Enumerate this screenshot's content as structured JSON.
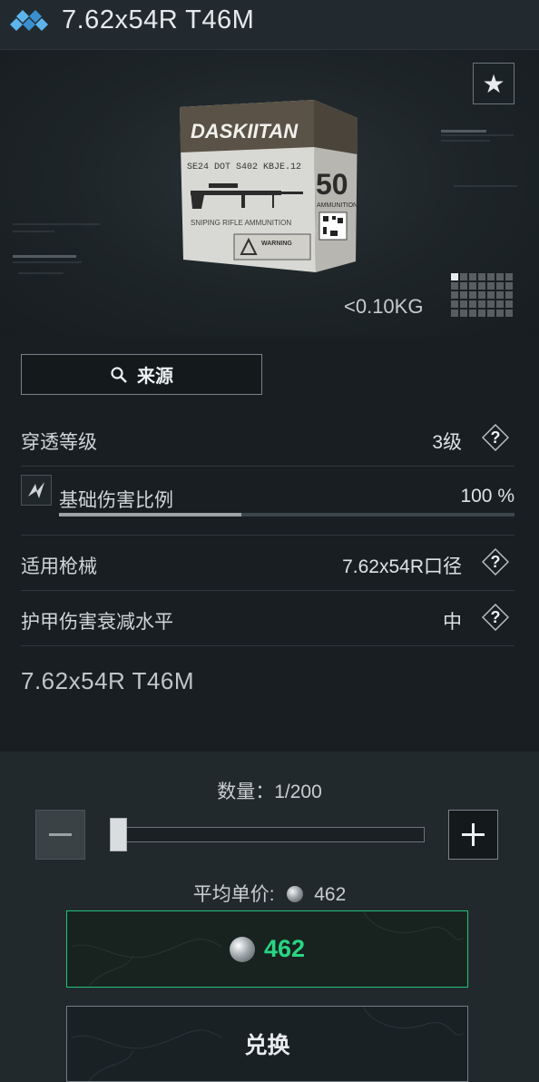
{
  "title": "7.62x54R T46M",
  "preview": {
    "weight": "<0.10KG",
    "box_brand": "DASKIITAN",
    "box_code": "SE24 DOT S402 KBJE.12",
    "box_caption": "SNIPING RIFLE AMMUNITION",
    "box_count": "50",
    "box_side_label": "AMMUNITION",
    "box_warning": "WARNING"
  },
  "source_button": "来源",
  "stats": {
    "penetration_label": "穿透等级",
    "penetration_value": "3级",
    "damage_label": "基础伤害比例",
    "damage_value": "100 %",
    "damage_fraction": 0.4,
    "weapons_label": "适用枪械",
    "weapons_value": "7.62x54R口径",
    "armor_label": "护甲伤害衰减水平",
    "armor_value": "中"
  },
  "item_name": "7.62x54R T46M",
  "purchase": {
    "quantity_label": "数量：1/200",
    "unit_price_label": "平均单价:",
    "unit_price_value": "462",
    "total_value": "462",
    "exchange_label": "兑换"
  },
  "colors": {
    "accent_green": "#27d683",
    "icon_blue": "#4aa3e0"
  }
}
